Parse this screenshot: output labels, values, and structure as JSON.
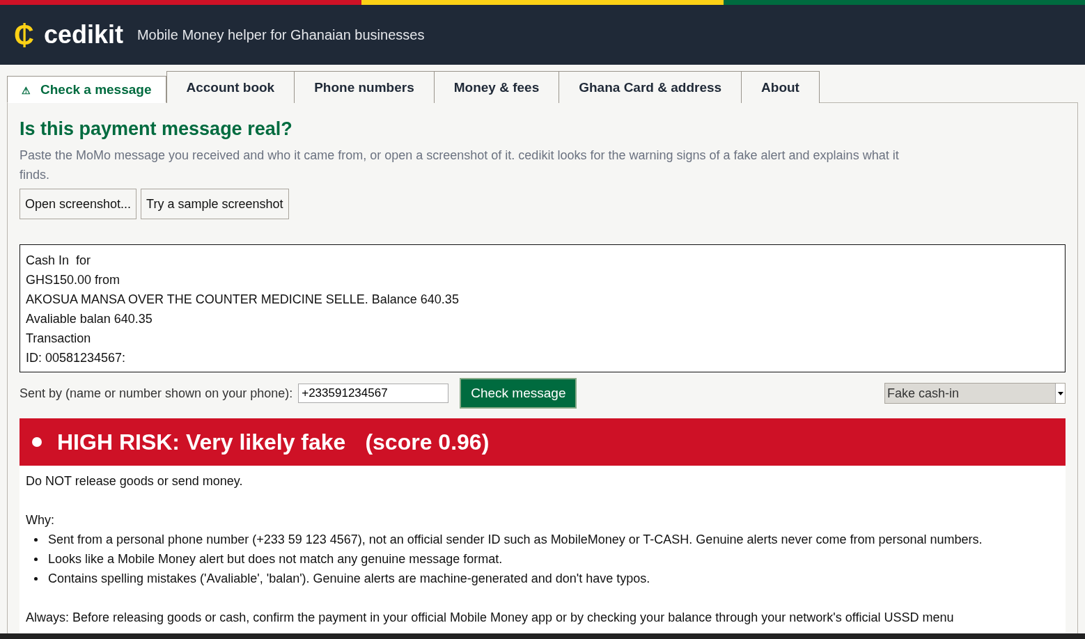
{
  "app": {
    "logo_symbol": "₵",
    "name": "cedikit",
    "tagline": "Mobile Money helper for Ghanaian businesses"
  },
  "tabs": [
    {
      "label": "Check a message",
      "icon": "⚠",
      "selected": true
    },
    {
      "label": "Account book",
      "selected": false
    },
    {
      "label": "Phone numbers",
      "selected": false
    },
    {
      "label": "Money & fees",
      "selected": false
    },
    {
      "label": "Ghana Card & address",
      "selected": false
    },
    {
      "label": "About",
      "selected": false
    }
  ],
  "check": {
    "heading": "Is this payment message real?",
    "intro": "Paste the MoMo message you received and who it came from, or open a screenshot of it. cedikit looks for the warning signs of a fake alert and explains what it finds.",
    "buttons": [
      "Open screenshot...",
      "Try a sample screenshot"
    ],
    "message_lines": [
      "Cash In  for",
      "GHS150.00 from",
      "AKOSUA MANSA OVER THE COUNTER MEDICINE SELLE. Balance 640.35",
      "Avaliable balan 640.35",
      "Transaction",
      "ID: 00581234567:"
    ],
    "sender_label": "Sent by (name or number shown on your phone):",
    "sender_value": "+233591234567",
    "check_button": "Check message",
    "sample_select": "Fake cash-in"
  },
  "result": {
    "headline": "HIGH RISK: Very likely fake",
    "score": "(score 0.96)",
    "advice": "Do NOT release goods or send money.",
    "why_label": "Why:",
    "reasons": [
      "Sent from a personal phone number (+233 59 123 4567), not an official sender ID such as MobileMoney or T-CASH. Genuine alerts never come from personal numbers.",
      "Looks like a Mobile Money alert but does not match any genuine message format.",
      "Contains spelling mistakes ('Avaliable', 'balan'). Genuine alerts are machine-generated and don't have typos."
    ],
    "always": "Always: Before releasing goods or cash, confirm the payment in your official Mobile Money app or by checking your balance through your network's official USSD menu"
  }
}
